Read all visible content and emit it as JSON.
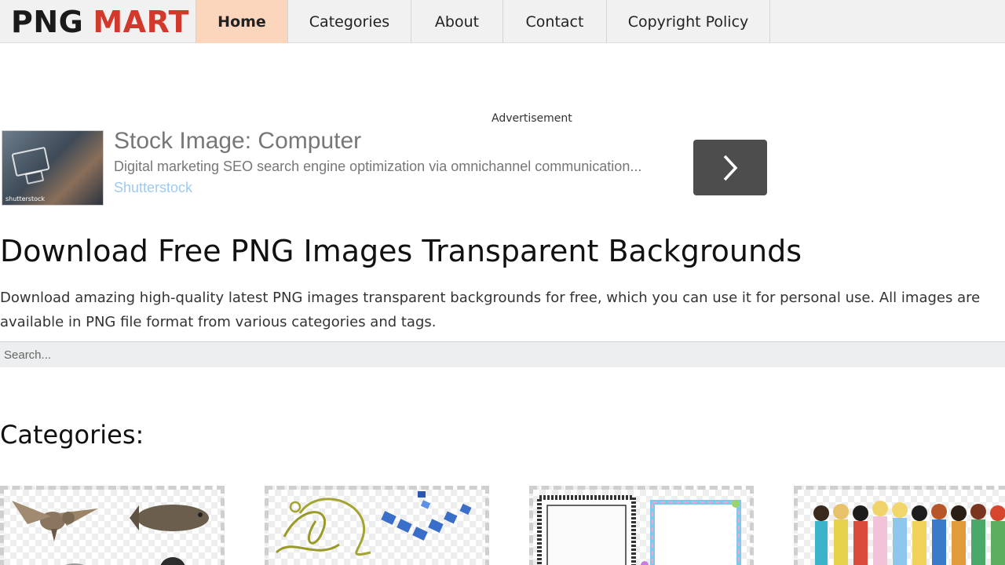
{
  "header": {
    "logo_part1": "PNG",
    "logo_part2": "MART",
    "nav": [
      "Home",
      "Categories",
      "About",
      "Contact",
      "Copyright Policy"
    ],
    "active_nav": "Home"
  },
  "ad": {
    "label": "Advertisement",
    "title": "Stock Image: Computer",
    "description": "Digital marketing SEO search engine optimization via omnichannel communication...",
    "source": "Shutterstock",
    "thumb_watermark": "shutterstock"
  },
  "main": {
    "title": "Download Free PNG Images Transparent Backgrounds",
    "intro": "Download amazing high-quality latest PNG images transparent backgrounds for free, which you can use it for personal use. All images are available in PNG file format from various categories and tags.",
    "search_placeholder": "Search...",
    "categories_title": "Categories:"
  },
  "categories": [
    {
      "name": "animals-category-card"
    },
    {
      "name": "decorative-category-card"
    },
    {
      "name": "frames-category-card"
    },
    {
      "name": "cartoons-category-card"
    }
  ],
  "colors": {
    "logo_accent": "#d0392b",
    "nav_active_bg": "#fcd5bd",
    "header_bg": "#f1f1f1",
    "ad_button_bg": "#4d4d4d"
  }
}
